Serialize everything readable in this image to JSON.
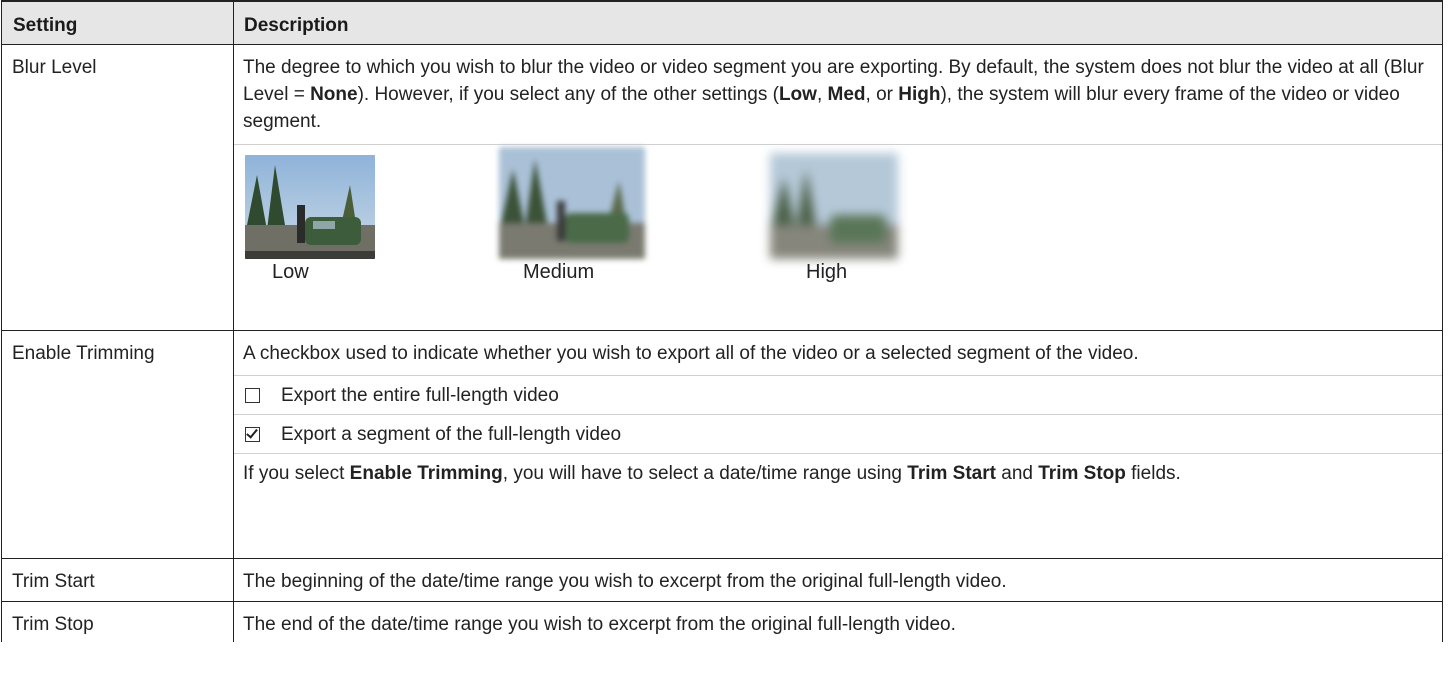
{
  "table": {
    "header": {
      "setting": "Setting",
      "description": "Description"
    },
    "blur": {
      "setting": "Blur Level",
      "desc_a": "The degree to which you wish to blur the video or video segment you are exporting. By default, the system does not blur the video at all (Blur Level = ",
      "desc_none": "None",
      "desc_b": "). However, if you select any of the other settings (",
      "desc_low": "Low",
      "desc_c": ", ",
      "desc_med": "Med",
      "desc_d": ", or ",
      "desc_high": "High",
      "desc_e": "), the system will blur every frame of the video or video segment.",
      "captions": {
        "low": "Low",
        "medium": "Medium",
        "high": "High"
      }
    },
    "trimming": {
      "setting": "Enable Trimming",
      "desc": "A checkbox used to indicate whether you wish to export all of the video or a selected segment of the video.",
      "option_entire": "Export the entire full-length video",
      "option_segment": "Export a segment of the full-length video",
      "note_a": "If you select ",
      "note_enable": "Enable Trimming",
      "note_b": ", you will have to select a date/time range using ",
      "note_start": "Trim Start",
      "note_c": " and ",
      "note_stop": "Trim Stop",
      "note_d": " fields."
    },
    "trim_start": {
      "setting": "Trim Start",
      "desc": "The beginning of the date/time range you wish to excerpt from the original full-length video."
    },
    "trim_stop": {
      "setting": "Trim Stop",
      "desc": "The end of the date/time range you wish to excerpt from the original full-length video."
    }
  },
  "icons": {
    "unchecked": "checkbox-unchecked-icon",
    "checked": "checkbox-checked-icon"
  },
  "colors": {
    "header_bg": "#e6e6e6",
    "border": "#222222"
  }
}
